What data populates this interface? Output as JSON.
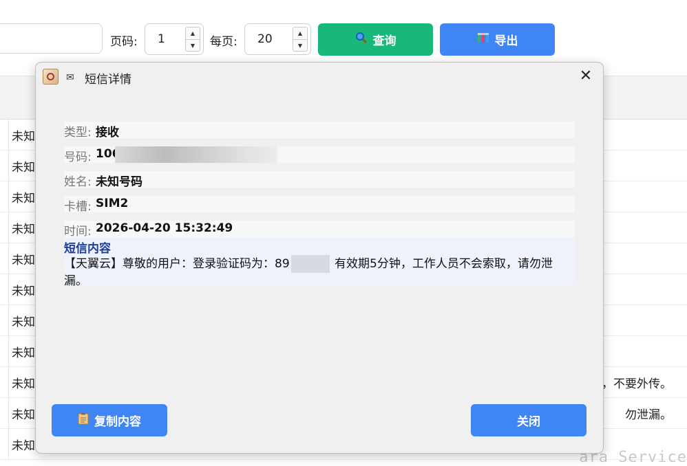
{
  "toolbar": {
    "page_label": "页码:",
    "page_value": "1",
    "per_page_label": "每页:",
    "per_page_value": "20",
    "query_label": "查询",
    "export_label": "导出",
    "query_color": "#18b87a",
    "export_color": "#3f86f4"
  },
  "table": {
    "rows": [
      {
        "first": "未知",
        "tail": ""
      },
      {
        "first": "未知",
        "tail": ""
      },
      {
        "first": "未知",
        "tail": ""
      },
      {
        "first": "未知",
        "tail": ""
      },
      {
        "first": "未知",
        "tail": ""
      },
      {
        "first": "未知",
        "tail": ""
      },
      {
        "first": "未知",
        "tail": ""
      },
      {
        "first": "未知",
        "tail": ""
      },
      {
        "first": "未知",
        "tail": "，不要外传。"
      },
      {
        "first": "未知",
        "tail": "勿泄漏。"
      },
      {
        "first": "未知",
        "tail": ""
      }
    ]
  },
  "watermark": "ara Service",
  "dialog": {
    "title_icon": "envelope-icon",
    "title": "短信详情",
    "close_glyph": "✕",
    "fields": {
      "type_label": "类型:",
      "type_value": "接收",
      "number_label": "号码:",
      "number_value": "106",
      "name_label": "姓名:",
      "name_value": "未知号码",
      "slot_label": "卡槽:",
      "slot_value": "SIM2",
      "time_label": "时间:",
      "time_value": "2026-04-20 15:32:49"
    },
    "content_title": "短信内容",
    "content_before": "【天翼云】尊敬的用户：登录验证码为：89",
    "content_after": " 有效期5分钟，工作人员不会索取，请勿泄漏。",
    "copy_button": "复制内容",
    "close_button": "关闭",
    "accent_color": "#3f86f4",
    "content_title_color": "#1f3c9b"
  }
}
